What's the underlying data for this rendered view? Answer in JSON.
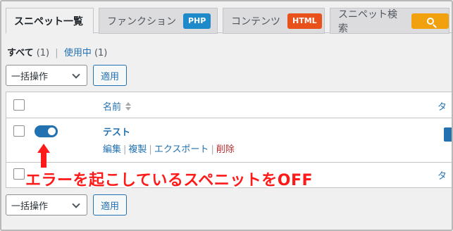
{
  "tabs": {
    "snippet_list": "スニペット一覧",
    "functions": "ファンクション",
    "functions_badge": "PHP",
    "content": "コンテンツ",
    "content_badge": "HTML",
    "snippet_search": "スニペット検索",
    "search_icon": "search-icon"
  },
  "filters": {
    "all_label": "すべて",
    "all_count": "(1)",
    "separator": "|",
    "active_label": "使用中",
    "active_count": "(1)"
  },
  "bulk_top": {
    "select_value": "一括操作",
    "apply_label": "適用"
  },
  "bulk_bottom": {
    "select_value": "一括操作",
    "apply_label": "適用"
  },
  "table": {
    "col_name": "名前",
    "col_tag": "タ",
    "rows": [
      {
        "title": "テスト",
        "active": true,
        "actions": {
          "edit": "編集",
          "copy": "複製",
          "export": "エクスポート",
          "delete": "削除"
        }
      },
      {
        "col_tag": "タ"
      }
    ]
  },
  "annotation": {
    "text": "エラーを起こしているスペニットをOFF",
    "color": "#ff1a1a"
  },
  "colors": {
    "accent": "#2271b1",
    "php_badge": "#1f8ac9",
    "html_badge": "#e9511b",
    "search_badge": "#f0a10d",
    "delete": "#b32d2e"
  }
}
